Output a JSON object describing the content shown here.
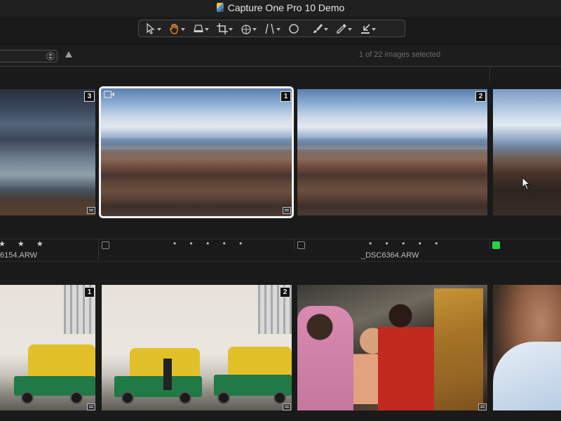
{
  "window": {
    "title": "Capture One Pro 10 Demo"
  },
  "toolbar": {
    "tools": [
      {
        "name": "select-tool",
        "caret": true
      },
      {
        "name": "pan-tool",
        "caret": true,
        "active": true
      },
      {
        "name": "straighten-tool",
        "caret": true
      },
      {
        "name": "crop-tool",
        "caret": true
      },
      {
        "name": "rotate-tool",
        "caret": true
      },
      {
        "name": "keystone-tool",
        "caret": true
      },
      {
        "name": "spot-removal-tool",
        "caret": false
      },
      {
        "name": "brush-tool",
        "caret": true
      },
      {
        "name": "color-picker-tool",
        "caret": true
      },
      {
        "name": "copy-apply-tool",
        "caret": true
      }
    ],
    "accent": "#f08a2c"
  },
  "browser": {
    "selection_status": "1 of 22 images selected"
  },
  "row1": {
    "thumbs": [
      {
        "badge": "3"
      },
      {
        "badge": "1",
        "selected": true,
        "video": true
      },
      {
        "badge": "2"
      },
      {
        "badge": ""
      }
    ],
    "info": {
      "stars": "★ ★ ★",
      "dots1": "• • • • •",
      "dots2": "• • • • •",
      "name_left": "6154.ARW",
      "name_center": "_DSC6364.ARW"
    },
    "color_tag": "#2bd14a"
  },
  "row2": {
    "thumbs": [
      {
        "badge": "1"
      },
      {
        "badge": "2"
      },
      {
        "badge": ""
      },
      {
        "badge": ""
      }
    ]
  }
}
